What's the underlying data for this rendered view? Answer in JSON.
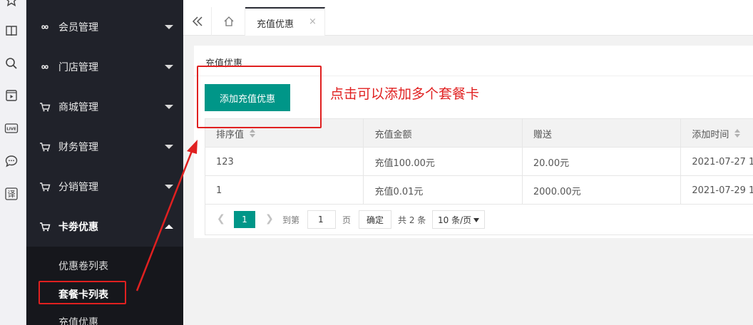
{
  "sidebar": {
    "menu": [
      {
        "label": "会员管理"
      },
      {
        "label": "门店管理"
      },
      {
        "label": "商城管理"
      },
      {
        "label": "财务管理"
      },
      {
        "label": "分销管理"
      },
      {
        "label": "卡劵优惠"
      }
    ],
    "submenu": [
      {
        "label": "优惠卷列表"
      },
      {
        "label": "套餐卡列表"
      },
      {
        "label": "充值优惠"
      }
    ]
  },
  "browser_strip": {
    "live_label": "LIVE",
    "translate_label": "译"
  },
  "tabbar": {
    "tab_label": "充值优惠",
    "close_glyph": "×"
  },
  "card": {
    "title": "充值优惠",
    "add_button": "添加充值优惠"
  },
  "table": {
    "headers": [
      "排序值",
      "充值金额",
      "赠送",
      "添加时间"
    ],
    "rows": [
      [
        "123",
        "充值100.00元",
        "20.00元",
        "2021-07-27 1"
      ],
      [
        "1",
        "充值0.01元",
        "2000.00元",
        "2021-07-29 1"
      ]
    ]
  },
  "pager": {
    "current_page": "1",
    "goto_label": "到第",
    "goto_value": "1",
    "page_unit": "页",
    "confirm": "确定",
    "total": "共 2 条",
    "page_size": "10 条/页"
  },
  "annotation": {
    "text": "点击可以添加多个套餐卡"
  },
  "colors": {
    "accent": "#009688",
    "sidebar_bg": "#20222a",
    "annotation": "#e02020"
  }
}
